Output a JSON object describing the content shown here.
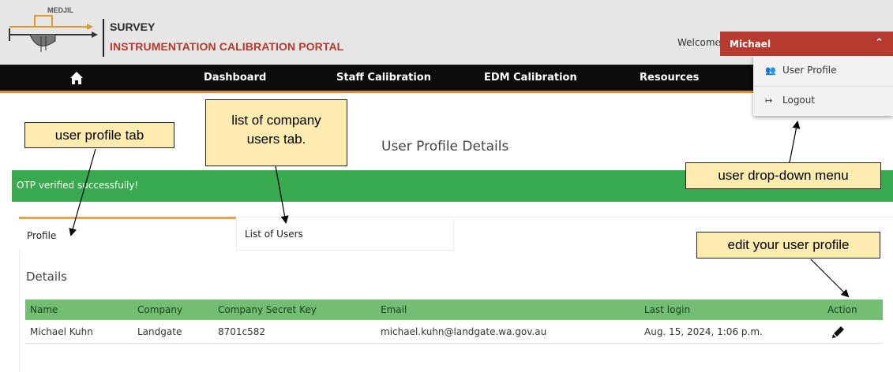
{
  "brand": {
    "logo_text": "MEDJIL",
    "line1": "SURVEY",
    "line2": "INSTRUMENTATION CALIBRATION PORTAL"
  },
  "header": {
    "welcome": "Welcome",
    "user_name": "Michael"
  },
  "nav": {
    "items": [
      "Dashboard",
      "Staff Calibration",
      "EDM Calibration",
      "Resources"
    ]
  },
  "user_menu": {
    "items": [
      {
        "label": "User Profile",
        "icon": "users-icon"
      },
      {
        "label": "Logout",
        "icon": "logout-icon"
      }
    ]
  },
  "page": {
    "title": "User Profile Details",
    "alert": "OTP verified successfully!"
  },
  "tabs": {
    "profile": "Profile",
    "users": "List of Users"
  },
  "details": {
    "title": "Details",
    "columns": [
      "Name",
      "Company",
      "Company Secret Key",
      "Email",
      "Last login",
      "Action"
    ],
    "rows": [
      {
        "name": "Michael Kuhn",
        "company": "Landgate",
        "secret_key": "8701c582",
        "email": "michael.kuhn@landgate.wa.gov.au",
        "last_login": "Aug. 15, 2024, 1:06 p.m."
      }
    ]
  },
  "annotations": {
    "profile_tab": "user profile tab",
    "users_tab_line1": "list of company",
    "users_tab_line2": "users tab.",
    "dropdown": "user drop-down menu",
    "edit": "edit your user profile"
  },
  "colors": {
    "accent_red": "#b73a2e",
    "nav_black": "#0c0c0c",
    "nav_underline": "#e88d2c",
    "success_green": "#38a94f",
    "table_header_green": "#72be72",
    "annotation_fill": "#fcecb0"
  }
}
